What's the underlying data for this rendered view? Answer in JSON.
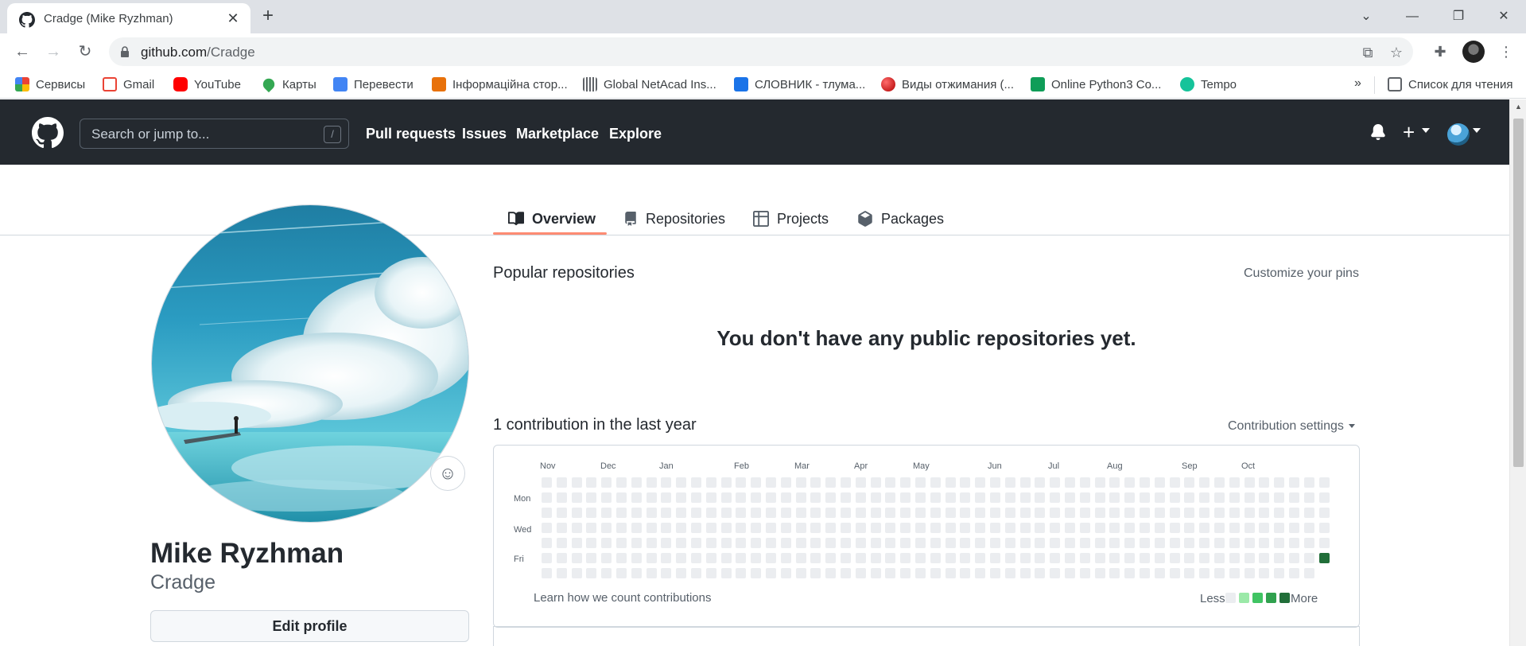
{
  "browser": {
    "tab_title": "Cradge (Mike Ryzhman)",
    "url_host": "github.com",
    "url_path": "/Cradge",
    "bookmarks": [
      {
        "label": "Сервисы",
        "icon": "apps-grid-icon",
        "color": "#4285f4"
      },
      {
        "label": "Gmail",
        "icon": "gmail-icon",
        "color": "#ea4335"
      },
      {
        "label": "YouTube",
        "icon": "youtube-icon",
        "color": "#ff0000"
      },
      {
        "label": "Карты",
        "icon": "maps-pin-icon",
        "color": "#34a853"
      },
      {
        "label": "Перевести",
        "icon": "translate-icon",
        "color": "#4285f4"
      },
      {
        "label": "Інформаційна стор...",
        "icon": "info-site-icon",
        "color": "#e8710a"
      },
      {
        "label": "Global NetAcad Ins...",
        "icon": "cisco-icon",
        "color": "#5f6368"
      },
      {
        "label": "СЛОВНИК - тлума...",
        "icon": "dictionary-icon",
        "color": "#1a73e8"
      },
      {
        "label": "Виды отжимания (...",
        "icon": "red-ball-icon",
        "color": "#d50000"
      },
      {
        "label": "Online Python3 Co...",
        "icon": "code-icon",
        "color": "#0f9d58"
      },
      {
        "label": "Tempo",
        "icon": "grammarly-icon",
        "color": "#15c39a"
      }
    ],
    "more_label": "»",
    "reading_list_label": "Список для чтения"
  },
  "header": {
    "search_placeholder": "Search or jump to...",
    "search_shortcut": "/",
    "nav": [
      "Pull requests",
      "Issues",
      "Marketplace",
      "Explore"
    ]
  },
  "profile_tabs": [
    {
      "label": "Overview",
      "icon": "book-icon",
      "active": true
    },
    {
      "label": "Repositories",
      "icon": "repo-icon",
      "active": false
    },
    {
      "label": "Projects",
      "icon": "table-icon",
      "active": false
    },
    {
      "label": "Packages",
      "icon": "package-icon",
      "active": false
    }
  ],
  "profile": {
    "name": "Mike Ryzhman",
    "username": "Cradge",
    "edit_label": "Edit profile"
  },
  "popular": {
    "title": "Popular repositories",
    "customize_label": "Customize your pins",
    "empty_message": "You don't have any public repositories yet."
  },
  "contributions": {
    "title": "1 contribution in the last year",
    "settings_label": "Contribution settings",
    "months": [
      "Nov",
      "Dec",
      "Jan",
      "Feb",
      "Mar",
      "Apr",
      "May",
      "Jun",
      "Jul",
      "Aug",
      "Sep",
      "Oct"
    ],
    "day_labels": [
      "Mon",
      "Wed",
      "Fri"
    ],
    "weeks": 53,
    "last_week_days": 6,
    "active_cell": {
      "week": 52,
      "day": 5,
      "level": 4
    },
    "learn_label": "Learn how we count contributions",
    "legend_less": "Less",
    "legend_more": "More",
    "level_colors": [
      "#ebedf0",
      "#9be9a8",
      "#40c463",
      "#30a14e",
      "#216e39"
    ]
  }
}
